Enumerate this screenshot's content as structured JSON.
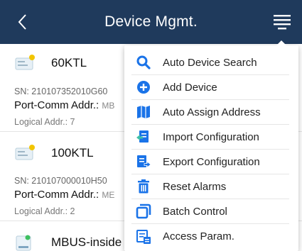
{
  "header": {
    "title": "Device Mgmt.",
    "back_icon": "chevron-left-icon",
    "menu_icon": "hamburger-menu-icon",
    "color": "#1f3a5c"
  },
  "devices": [
    {
      "name": "60KTL",
      "sn": "SN:  210107352010G60",
      "port_label": "Port-Comm Addr.:",
      "port_value": "MB",
      "logical": "Logical Addr.:  7",
      "icon": "inverter-device-icon"
    },
    {
      "name": "100KTL",
      "sn": "SN:  210107000010H50",
      "port_label": "Port-Comm Addr.:",
      "port_value": "ME",
      "logical": "Logical Addr.:  2",
      "icon": "inverter-device-icon"
    },
    {
      "name": "MBUS-inside",
      "icon": "mbus-device-icon"
    }
  ],
  "menu": {
    "accent_color": "#1a73e8",
    "items": [
      {
        "label": "Auto Device Search",
        "icon": "search-icon"
      },
      {
        "label": "Add Device",
        "icon": "add-circle-icon"
      },
      {
        "label": "Auto Assign Address",
        "icon": "map-icon"
      },
      {
        "label": "Import Configuration",
        "icon": "import-icon"
      },
      {
        "label": "Export Configuration",
        "icon": "export-icon"
      },
      {
        "label": "Reset Alarms",
        "icon": "trash-icon"
      },
      {
        "label": "Batch Control",
        "icon": "batch-control-icon"
      },
      {
        "label": "Access Param.",
        "icon": "access-param-icon"
      }
    ]
  }
}
